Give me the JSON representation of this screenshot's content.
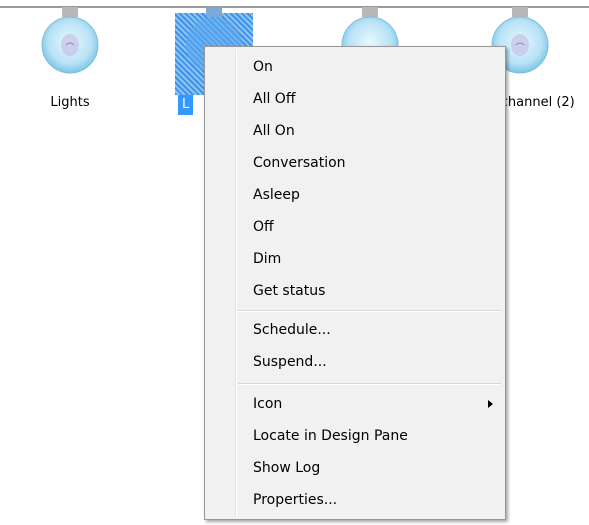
{
  "devices": [
    {
      "label": "Lights"
    },
    {
      "label": "L"
    },
    {
      "label": ""
    },
    {
      "label": "l channel (2)"
    }
  ],
  "context_menu": {
    "items": [
      {
        "label": "On"
      },
      {
        "label": "All Off"
      },
      {
        "label": "All On"
      },
      {
        "label": "Conversation"
      },
      {
        "label": "Asleep"
      },
      {
        "label": "Off"
      },
      {
        "label": "Dim"
      },
      {
        "label": "Get status"
      },
      {
        "label": "Schedule..."
      },
      {
        "label": "Suspend..."
      },
      {
        "label": "Icon",
        "submenu": true
      },
      {
        "label": "Locate in Design Pane"
      },
      {
        "label": "Show Log"
      },
      {
        "label": "Properties..."
      }
    ]
  },
  "colors": {
    "selection": "#3399ff",
    "menu_bg": "#f1f1f1",
    "bulb_glass": "#bfe6f7",
    "bulb_cap": "#b8b8b8"
  }
}
